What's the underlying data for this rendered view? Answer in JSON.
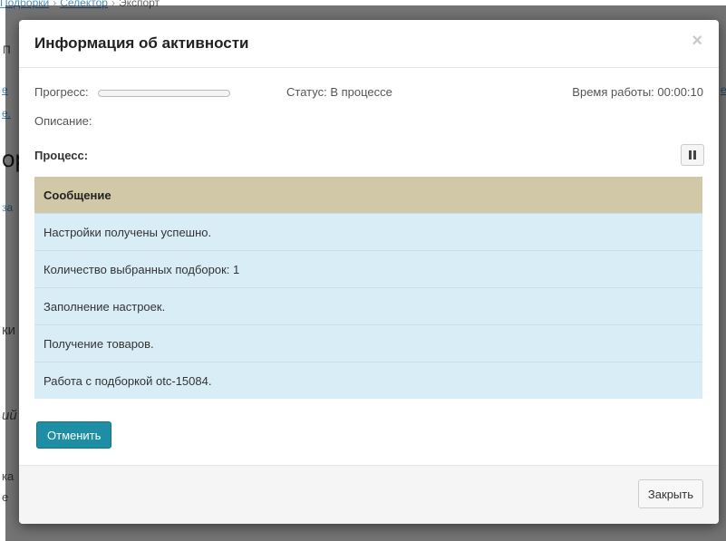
{
  "background": {
    "breadcrumb": [
      "Подборки",
      "Селектор",
      "Экспорт"
    ],
    "fragments": [
      "П",
      "е",
      "е.",
      "ор",
      "за",
      "ки",
      "ий",
      "ка",
      "е"
    ]
  },
  "modal": {
    "title": "Информация об активности",
    "close_glyph": "×",
    "progress_label": "Прогресс:",
    "progress_value": 0.0,
    "status": "Статус: В процессе",
    "work_time": "Время работы: 00:00:10",
    "description_label": "Описание:",
    "process_label": "Процесс:",
    "pause_icon": "pause-icon",
    "table": {
      "header": "Сообщение",
      "rows": [
        "Настройки получены успешно.",
        "Количество выбранных подборок: 1",
        "Заполнение настроек.",
        "Получение товаров.",
        "Работа с подборкой otc-15084."
      ]
    },
    "cancel_label": "Отменить",
    "footer_close_label": "Закрыть"
  },
  "colors": {
    "table_header": "#d1c8a8",
    "table_row": "#d9edf7",
    "primary_button": "#1d8ea3"
  }
}
